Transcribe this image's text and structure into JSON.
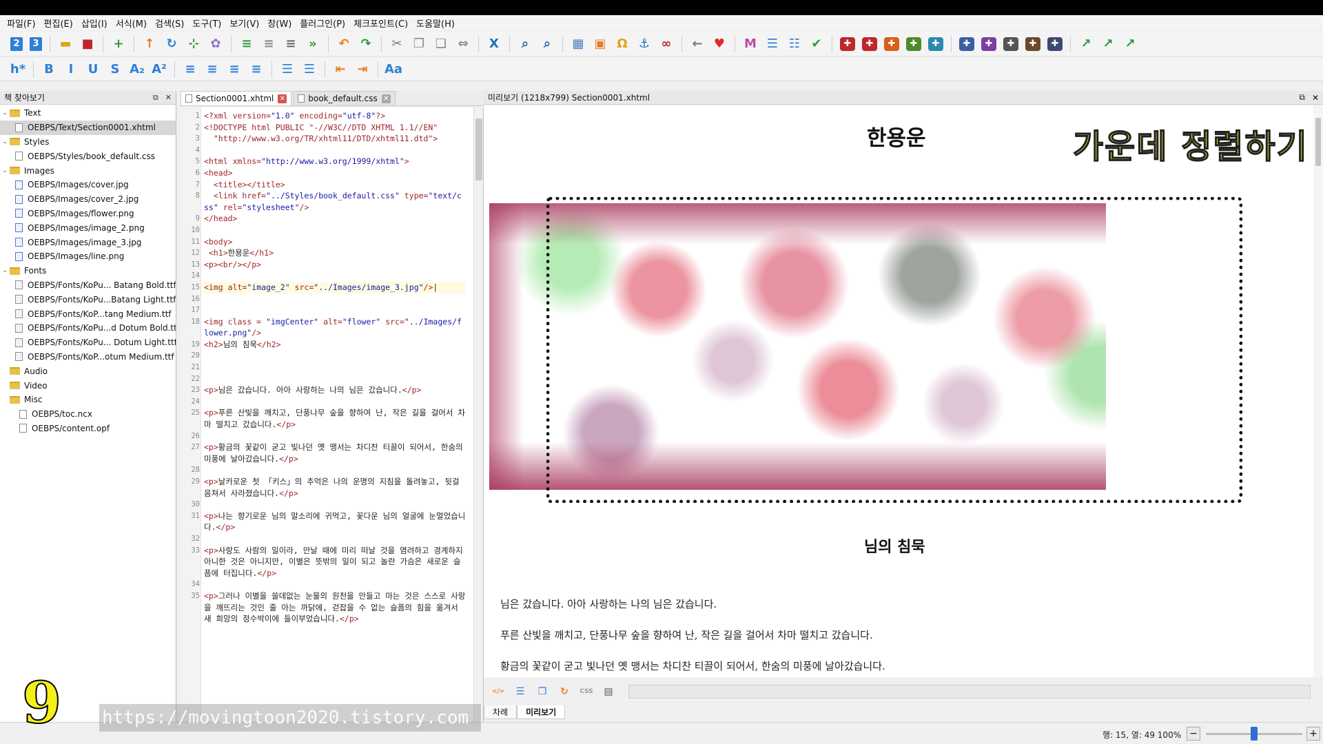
{
  "menu": [
    "파일(F)",
    "편집(E)",
    "삽입(I)",
    "서식(M)",
    "검색(S)",
    "도구(T)",
    "보기(V)",
    "창(W)",
    "플러그인(P)",
    "체크포인트(C)",
    "도움말(H)"
  ],
  "toolbar": {
    "buttons": [
      {
        "name": "number-2-button",
        "glyph": "2",
        "color": "#2e7fd8"
      },
      {
        "name": "number-3-button",
        "glyph": "3",
        "color": "#2e7fd8"
      },
      {
        "name": "open-folder-button",
        "glyph": "▬",
        "color": "#e3a21a"
      },
      {
        "name": "save-button",
        "glyph": "■",
        "color": "#c0262d"
      },
      {
        "name": "add-button",
        "glyph": "+",
        "color": "#2a9a3a"
      },
      {
        "name": "arrow-up-button",
        "glyph": "↑",
        "color": "#e67e22"
      },
      {
        "name": "rotate-button",
        "glyph": "↻",
        "color": "#2e7fd8"
      },
      {
        "name": "insert-button",
        "glyph": "⊹",
        "color": "#2a9a3a"
      },
      {
        "name": "settings-button",
        "glyph": "✿",
        "color": "#8e6fd6"
      },
      {
        "name": "split-button",
        "glyph": "≡",
        "color": "#2a9a3a"
      },
      {
        "name": "merge-button",
        "glyph": "≡",
        "color": "#888888"
      },
      {
        "name": "toc-button",
        "glyph": "≡",
        "color": "#666666"
      },
      {
        "name": "forward-button",
        "glyph": "»",
        "color": "#2a9a3a"
      },
      {
        "name": "undo-button",
        "glyph": "↶",
        "color": "#e67e22"
      },
      {
        "name": "redo-button",
        "glyph": "↷",
        "color": "#2a9a3a"
      },
      {
        "name": "cut-button",
        "glyph": "✂",
        "color": "#777777"
      },
      {
        "name": "copy-button",
        "glyph": "❐",
        "color": "#888888"
      },
      {
        "name": "paste-button",
        "glyph": "❏",
        "color": "#888888"
      },
      {
        "name": "link-code-button",
        "glyph": "⇔",
        "color": "#888888"
      },
      {
        "name": "close-tag-button",
        "glyph": "X",
        "color": "#1e6fb8"
      },
      {
        "name": "find-button",
        "glyph": "⌕",
        "color": "#1e6fb8"
      },
      {
        "name": "find-next-button",
        "glyph": "⌕",
        "color": "#1e6fb8"
      },
      {
        "name": "metadata-button",
        "glyph": "▦",
        "color": "#4a7fbf"
      },
      {
        "name": "insert-image-button",
        "glyph": "▣",
        "color": "#e67e22"
      },
      {
        "name": "special-char-button",
        "glyph": "Ω",
        "color": "#e3a21a"
      },
      {
        "name": "anchor-button",
        "glyph": "⚓",
        "color": "#1e6fb8"
      },
      {
        "name": "hyperlink-button",
        "glyph": "∞",
        "color": "#c0262d"
      },
      {
        "name": "back-button",
        "glyph": "←",
        "color": "#777777"
      },
      {
        "name": "favorite-button",
        "glyph": "♥",
        "color": "#e0272e"
      },
      {
        "name": "meta-editor-button",
        "glyph": "M",
        "color": "#c04aa8"
      },
      {
        "name": "list-button",
        "glyph": "☰",
        "color": "#2e7fd8"
      },
      {
        "name": "toc-edit-button",
        "glyph": "☷",
        "color": "#2e7fd8"
      },
      {
        "name": "spellcheck-button",
        "glyph": "✔",
        "color": "#2a9a3a"
      },
      {
        "name": "plugin-1-button",
        "glyph": "✚",
        "color": "#c0262d"
      },
      {
        "name": "plugin-2-button",
        "glyph": "✚",
        "color": "#c0262d"
      },
      {
        "name": "plugin-3-button",
        "glyph": "✚",
        "color": "#d95f1a"
      },
      {
        "name": "plugin-4-button",
        "glyph": "✚",
        "color": "#4f8a2a"
      },
      {
        "name": "plugin-5-button",
        "glyph": "✚",
        "color": "#2a8ab0"
      },
      {
        "name": "plugin-6-button",
        "glyph": "✚",
        "color": "#3a5fa0"
      },
      {
        "name": "plugin-7-button",
        "glyph": "✚",
        "color": "#7a3fa0"
      },
      {
        "name": "plugin-8-button",
        "glyph": "✚",
        "color": "#555555"
      },
      {
        "name": "plugin-9-button",
        "glyph": "✚",
        "color": "#6b4a2a"
      },
      {
        "name": "plugin-10-button",
        "glyph": "✚",
        "color": "#3a4a70"
      },
      {
        "name": "checkpoint-1-button",
        "glyph": "↗",
        "color": "#2a9a3a"
      },
      {
        "name": "checkpoint-2-button",
        "glyph": "↗",
        "color": "#2a9a3a"
      },
      {
        "name": "checkpoint-3-button",
        "glyph": "↗",
        "color": "#2a9a3a"
      }
    ],
    "format_buttons": [
      {
        "name": "heading-button",
        "glyph": "h*",
        "color": "#2e7fd8"
      },
      {
        "name": "bold-button",
        "glyph": "B",
        "color": "#2e7fd8"
      },
      {
        "name": "italic-button",
        "glyph": "I",
        "color": "#2e7fd8"
      },
      {
        "name": "underline-button",
        "glyph": "U",
        "color": "#2e7fd8"
      },
      {
        "name": "strikethrough-button",
        "glyph": "S",
        "color": "#2e7fd8"
      },
      {
        "name": "subscript-button",
        "glyph": "A₂",
        "color": "#2e7fd8"
      },
      {
        "name": "superscript-button",
        "glyph": "A²",
        "color": "#2e7fd8"
      },
      {
        "name": "align-left-button",
        "glyph": "≡",
        "color": "#2e7fd8"
      },
      {
        "name": "align-center-button",
        "glyph": "≡",
        "color": "#2e7fd8"
      },
      {
        "name": "align-right-button",
        "glyph": "≡",
        "color": "#2e7fd8"
      },
      {
        "name": "justify-button",
        "glyph": "≡",
        "color": "#2e7fd8"
      },
      {
        "name": "bullet-list-button",
        "glyph": "☰",
        "color": "#2e7fd8"
      },
      {
        "name": "numbered-list-button",
        "glyph": "☰",
        "color": "#2e7fd8"
      },
      {
        "name": "outdent-button",
        "glyph": "⇤",
        "color": "#e67e22"
      },
      {
        "name": "indent-button",
        "glyph": "⇥",
        "color": "#e67e22"
      },
      {
        "name": "text-case-button",
        "glyph": "Aa",
        "color": "#2e7fd8"
      }
    ]
  },
  "book_browser": {
    "title": "책 찾아보기",
    "items": [
      {
        "label": "Text",
        "type": "folder",
        "level": 0
      },
      {
        "label": "OEBPS/Text/Section0001.xhtml",
        "type": "file",
        "level": 1,
        "selected": true
      },
      {
        "label": "Styles",
        "type": "folder",
        "level": 0
      },
      {
        "label": "OEBPS/Styles/book_default.css",
        "type": "file",
        "level": 1
      },
      {
        "label": "Images",
        "type": "folder",
        "level": 0
      },
      {
        "label": "OEBPS/Images/cover.jpg",
        "type": "img",
        "level": 1
      },
      {
        "label": "OEBPS/Images/cover_2.jpg",
        "type": "img",
        "level": 1
      },
      {
        "label": "OEBPS/Images/flower.png",
        "type": "img",
        "level": 1
      },
      {
        "label": "OEBPS/Images/image_2.png",
        "type": "img",
        "level": 1
      },
      {
        "label": "OEBPS/Images/image_3.jpg",
        "type": "img",
        "level": 1
      },
      {
        "label": "OEBPS/Images/line.png",
        "type": "img",
        "level": 1
      },
      {
        "label": "Fonts",
        "type": "folder",
        "level": 0
      },
      {
        "label": "OEBPS/Fonts/KoPu... Batang Bold.ttf",
        "type": "font",
        "level": 1
      },
      {
        "label": "OEBPS/Fonts/KoPu...Batang Light.ttf",
        "type": "font",
        "level": 1
      },
      {
        "label": "OEBPS/Fonts/KoP...tang Medium.ttf",
        "type": "font",
        "level": 1
      },
      {
        "label": "OEBPS/Fonts/KoPu...d Dotum Bold.ttf",
        "type": "font",
        "level": 1
      },
      {
        "label": "OEBPS/Fonts/KoPu... Dotum Light.ttf",
        "type": "font",
        "level": 1
      },
      {
        "label": "OEBPS/Fonts/KoP...otum Medium.ttf",
        "type": "font",
        "level": 1
      },
      {
        "label": "Audio",
        "type": "folder-leaf",
        "level": 0
      },
      {
        "label": "Video",
        "type": "folder-leaf",
        "level": 0
      },
      {
        "label": "Misc",
        "type": "folder-leaf",
        "level": 0
      },
      {
        "label": "OEBPS/toc.ncx",
        "type": "file-plain",
        "level": 0
      },
      {
        "label": "OEBPS/content.opf",
        "type": "file-plain",
        "level": 0
      }
    ]
  },
  "tabs": [
    {
      "label": "Section0001.xhtml",
      "active": true
    },
    {
      "label": "book_default.css",
      "active": false
    }
  ],
  "code": [
    {
      "n": "1",
      "html": "<span class=\"tag\">&lt;?xml</span> <span class=\"att\">version=</span><span class=\"str\">\"1.0\"</span> <span class=\"att\">encoding=</span><span class=\"str\">\"utf-8\"</span><span class=\"tag\">?&gt;</span>"
    },
    {
      "n": "2",
      "html": "<span class=\"tag\">&lt;!DOCTYPE html PUBLIC \"-//W3C//DTD XHTML 1.1//EN\"</span>"
    },
    {
      "n": "3",
      "html": "  <span class=\"tag\">\"http://www.w3.org/TR/xhtml11/DTD/xhtml11.dtd\"&gt;</span>"
    },
    {
      "n": "4",
      "html": ""
    },
    {
      "n": "5",
      "html": "<span class=\"tag\">&lt;html</span> <span class=\"att\">xmlns=</span><span class=\"str\">\"http://www.w3.org/1999/xhtml\"</span><span class=\"tag\">&gt;</span>"
    },
    {
      "n": "6",
      "html": "<span class=\"tag\">&lt;head&gt;</span>"
    },
    {
      "n": "7",
      "html": "  <span class=\"tag\">&lt;title&gt;&lt;/title&gt;</span>"
    },
    {
      "n": "8",
      "html": "  <span class=\"tag\">&lt;link</span> <span class=\"att\">href=</span><span class=\"str\">\"../Styles/book_default.css\"</span> <span class=\"att\">type=</span><span class=\"str\">\"text/css\"</span> <span class=\"att\">rel=</span><span class=\"str\">\"stylesheet\"</span><span class=\"tag\">/&gt;</span>"
    },
    {
      "n": "9",
      "html": "<span class=\"tag\">&lt;/head&gt;</span>"
    },
    {
      "n": "10",
      "html": ""
    },
    {
      "n": "11",
      "html": "<span class=\"tag\">&lt;body&gt;</span>"
    },
    {
      "n": "12",
      "html": " <span class=\"tag\">&lt;h1&gt;</span>한용운<span class=\"tag\">&lt;/h1&gt;</span>"
    },
    {
      "n": "13",
      "html": "<span class=\"tag\">&lt;p&gt;&lt;br/&gt;&lt;/p&gt;</span>"
    },
    {
      "n": "14",
      "html": ""
    },
    {
      "n": "15",
      "html": "<span class=\"tag\">&lt;img</span> <span class=\"att\">alt=</span><span class=\"str\">\"image_2\"</span> <span class=\"att\">src=</span><span class=\"str\">\"../Images/image_3.jpg\"</span><span class=\"tag\">/&gt;</span>|",
      "cur": true
    },
    {
      "n": "16",
      "html": ""
    },
    {
      "n": "17",
      "html": ""
    },
    {
      "n": "18",
      "html": "<span class=\"tag\">&lt;img</span> <span class=\"att\">class =</span> <span class=\"str\">\"imgCenter\"</span> <span class=\"att\">alt=</span><span class=\"str\">\"flower\"</span> <span class=\"att\">src=</span><span class=\"str\">\"../Images/flower.png\"</span><span class=\"tag\">/&gt;</span>"
    },
    {
      "n": "19",
      "html": "<span class=\"tag\">&lt;h2&gt;</span>님의 침묵<span class=\"tag\">&lt;/h2&gt;</span>"
    },
    {
      "n": "20",
      "html": ""
    },
    {
      "n": "21",
      "html": ""
    },
    {
      "n": "22",
      "html": ""
    },
    {
      "n": "23",
      "html": "<span class=\"tag\">&lt;p&gt;</span>님은 갔습니다. 아아 사랑하는 나의 님은 갔습니다.<span class=\"tag\">&lt;/p&gt;</span>"
    },
    {
      "n": "24",
      "html": ""
    },
    {
      "n": "25",
      "html": "<span class=\"tag\">&lt;p&gt;</span>푸른 산빛을 깨치고, 단풍나무 숲을 향하여 난, 작은 길을 걸어서 차마 떨치고 갔습니다.<span class=\"tag\">&lt;/p&gt;</span>"
    },
    {
      "n": "26",
      "html": ""
    },
    {
      "n": "27",
      "html": "<span class=\"tag\">&lt;p&gt;</span>황금의 꽃같이 굳고 빛나던 옛 맹서는 차디찬 티끌이 되어서, 한숨의 미풍에 날아갔습니다.<span class=\"tag\">&lt;/p&gt;</span>"
    },
    {
      "n": "28",
      "html": ""
    },
    {
      "n": "29",
      "html": "<span class=\"tag\">&lt;p&gt;</span>날카로운 첫 「키스」의 추억은 나의 운명의 지침을 돌려놓고, 뒷걸음쳐서 사라졌습니다.<span class=\"tag\">&lt;/p&gt;</span>"
    },
    {
      "n": "30",
      "html": ""
    },
    {
      "n": "31",
      "html": "<span class=\"tag\">&lt;p&gt;</span>나는 향기로운 님의 말소리에 귀먹고, 꽃다운 님의 얼굴에 눈멀었습니다.<span class=\"tag\">&lt;/p&gt;</span>"
    },
    {
      "n": "32",
      "html": ""
    },
    {
      "n": "33",
      "html": "<span class=\"tag\">&lt;p&gt;</span>사랑도 사람의 일이라, 만날 때에 미리 떠날 것을 염려하고 경계하지 아니한 것은 아니지만, 이별은 뜻밖의 일이 되고 놀란 가슴은 새로운 슬픔에 터집니다.<span class=\"tag\">&lt;/p&gt;</span>"
    },
    {
      "n": "34",
      "html": ""
    },
    {
      "n": "35",
      "html": "<span class=\"tag\">&lt;p&gt;</span>그러나 이별을 쓸데없는 눈물의 원천을 만들고 마는 것은 스스로 사랑을 깨뜨리는 것인 줄 아는 까닭에, 걷잡을 수 없는 슬픔의 힘을 옮겨서 새 희망의 정수박이에 들이부었습니다.<span class=\"tag\">&lt;/p&gt;</span>"
    }
  ],
  "preview": {
    "title": "미리보기 (1218x799) Section0001.xhtml",
    "h1": "한용운",
    "banner": "가운데 정렬하기",
    "h2": "님의 침묵",
    "paragraphs": [
      "님은 갔습니다. 아아 사랑하는 나의 님은 갔습니다.",
      "푸른 산빛을 깨치고, 단풍나무 숲을 향하여 난, 작은 길을 걸어서 차마 떨치고 갔습니다.",
      "황금의 꽃같이 굳고 빛나던 옛 맹서는 차디찬 티끌이 되어서, 한숨의 미풍에 날아갔습니다."
    ]
  },
  "preview_tools": [
    {
      "name": "code-view-icon",
      "glyph": "</>",
      "color": "#e67e22"
    },
    {
      "name": "list-view-icon",
      "glyph": "☰",
      "color": "#2e7fd8"
    },
    {
      "name": "copy-view-icon",
      "glyph": "❐",
      "color": "#2e7fd8"
    },
    {
      "name": "refresh-icon",
      "glyph": "↻",
      "color": "#e67e22"
    },
    {
      "name": "css-icon",
      "glyph": "CSS",
      "color": "#999999"
    },
    {
      "name": "print-icon",
      "glyph": "▤",
      "color": "#555555"
    }
  ],
  "bottom_tabs": [
    "차례",
    "미리보기"
  ],
  "status": {
    "position": "행: 15, 열: 49",
    "zoom": "100%",
    "zoom_slider_level": 0.5
  },
  "overlay": {
    "chapter": "9",
    "watermark": "https://movingtoon2020.tistory.com"
  }
}
